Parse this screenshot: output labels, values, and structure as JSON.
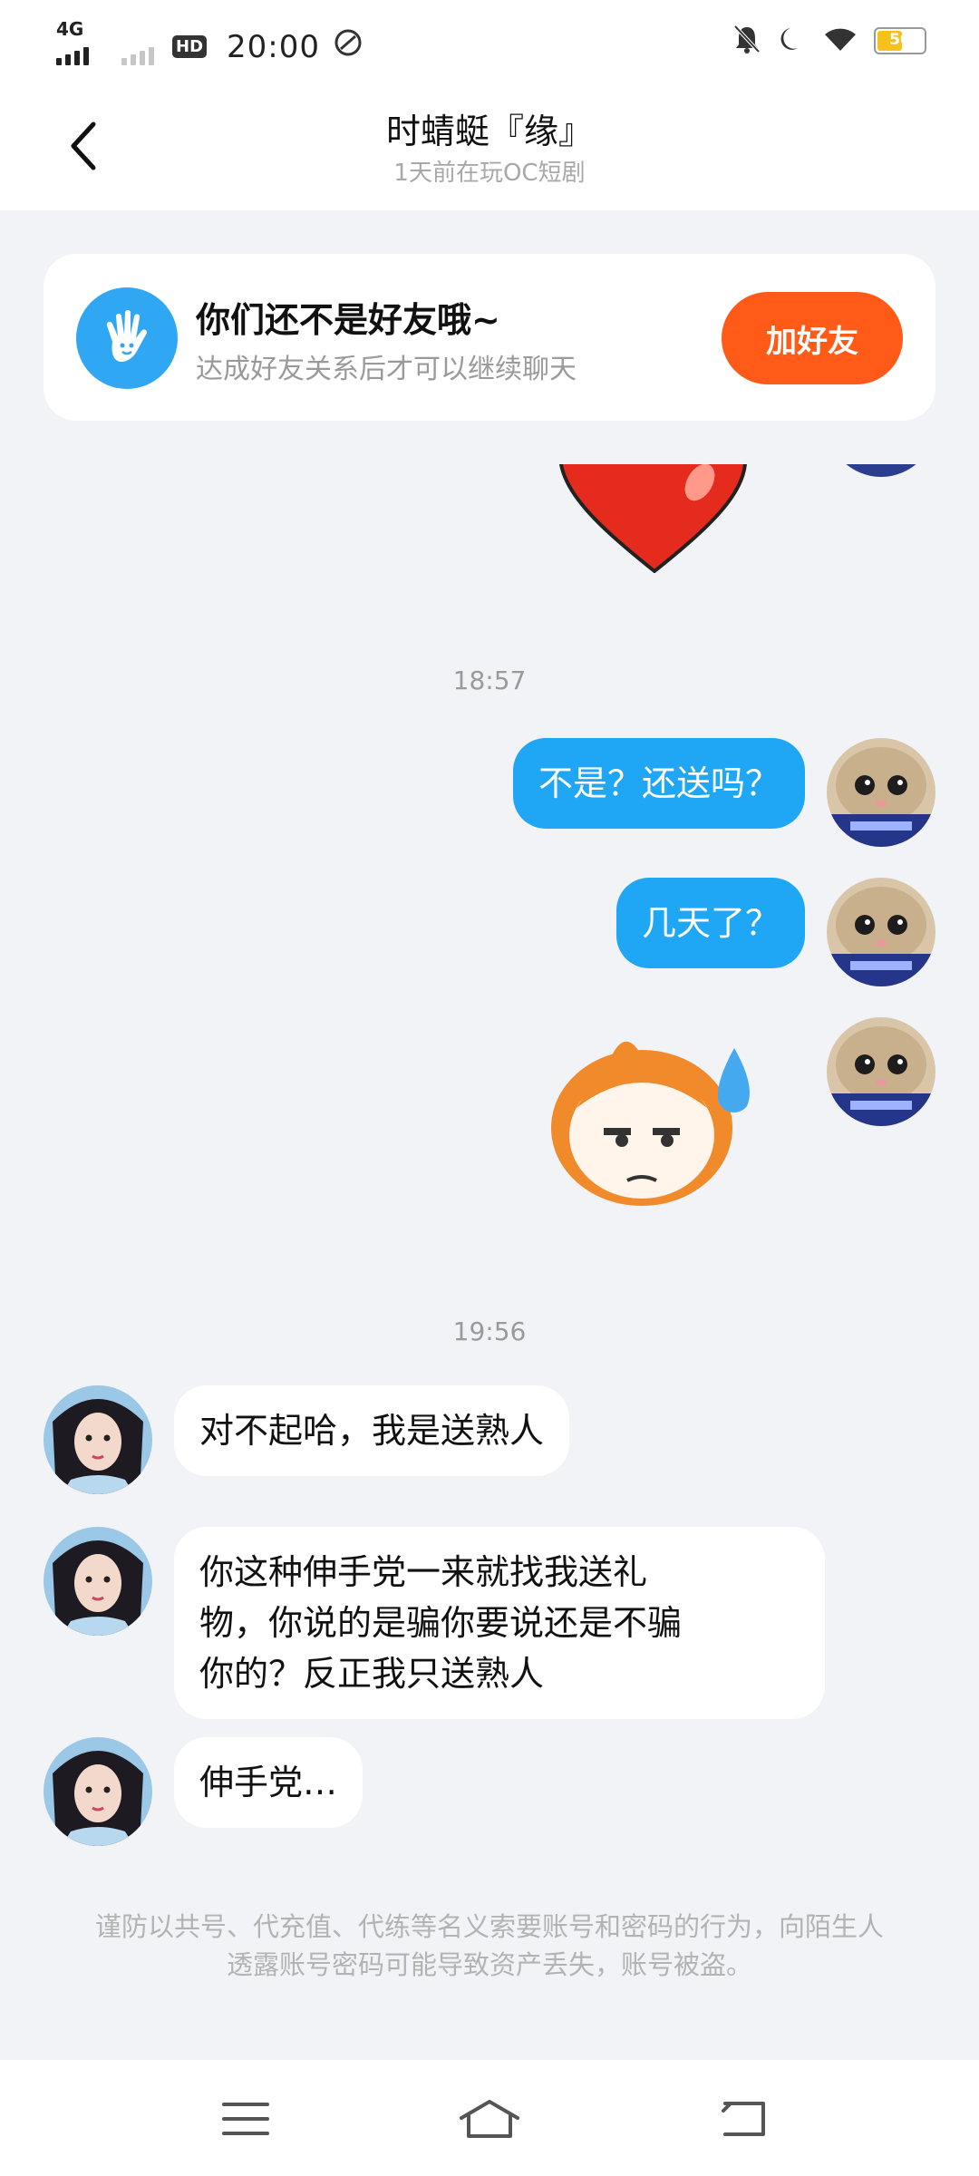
{
  "status_bar": {
    "network": "4G",
    "hd": "HD",
    "time": "20:00",
    "battery": "50"
  },
  "header": {
    "title": "时蜻蜓『缘』",
    "subtitle": "1天前在玩OC短剧"
  },
  "friend_card": {
    "title": "你们还不是好友哦~",
    "subtitle": "达成好友关系后才可以继续聊天",
    "button": "加好友"
  },
  "messages": {
    "time1": "18:57",
    "out1": "不是？还送吗？",
    "out2": "几天了？",
    "time2": "19:56",
    "in1": "对不起哈，我是送熟人",
    "in2_line1": "你这种伸手党一来就找我送礼",
    "in2_line2": "物，你说的是骗你要说还是不骗",
    "in2_line3": "你的？反正我只送熟人",
    "in3": "伸手党…"
  },
  "notice": "谨防以共号、代充值、代练等名义索要账号和密码的行为，向陌生人透露账号密码可能导致资产丢失，账号被盗。",
  "colors": {
    "outgoing_bubble": "#1fa7f5",
    "add_friend_button": "#ff5a17",
    "background": "#f1f3f7"
  }
}
